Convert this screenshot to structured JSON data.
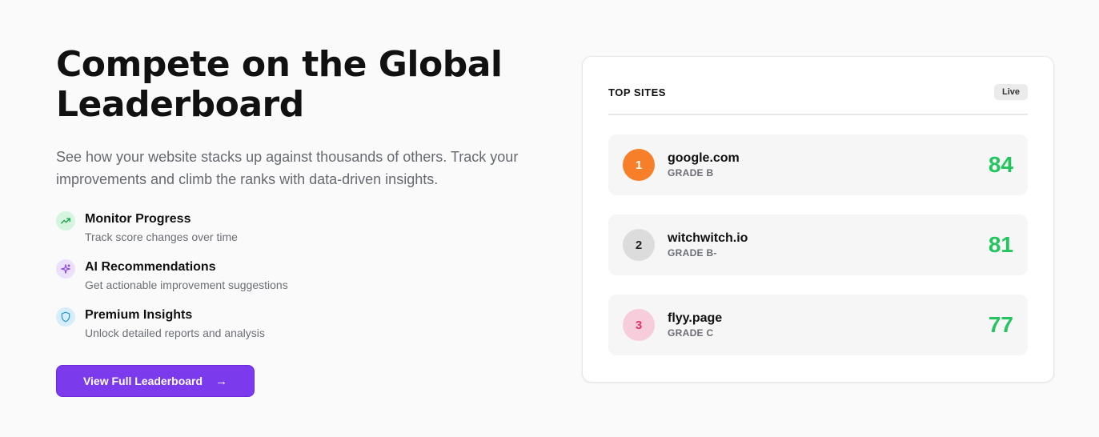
{
  "hero": {
    "headline_line1": "Compete on the Global",
    "headline_line2": "Leaderboard",
    "subtitle": "See how your website stacks up against thousands of others. Track your improvements and climb the ranks with data-driven insights."
  },
  "features": [
    {
      "icon": "trending-up-icon",
      "title": "Monitor Progress",
      "description": "Track score changes over time"
    },
    {
      "icon": "sparkles-icon",
      "title": "AI Recommendations",
      "description": "Get actionable improvement suggestions"
    },
    {
      "icon": "shield-icon",
      "title": "Premium Insights",
      "description": "Unlock detailed reports and analysis"
    }
  ],
  "cta": {
    "label": "View Full Leaderboard",
    "arrow": "→"
  },
  "leaderboard": {
    "title": "TOP SITES",
    "badge": "Live",
    "sites": [
      {
        "rank": "1",
        "name": "google.com",
        "grade": "GRADE B",
        "score": "84"
      },
      {
        "rank": "2",
        "name": "witchwitch.io",
        "grade": "GRADE B-",
        "score": "81"
      },
      {
        "rank": "3",
        "name": "flyy.page",
        "grade": "GRADE C",
        "score": "77"
      }
    ]
  },
  "colors": {
    "accent": "#7c3aed",
    "score_green": "#22c55e",
    "rank1": "#f77f2a",
    "rank3": "#e0336b"
  }
}
